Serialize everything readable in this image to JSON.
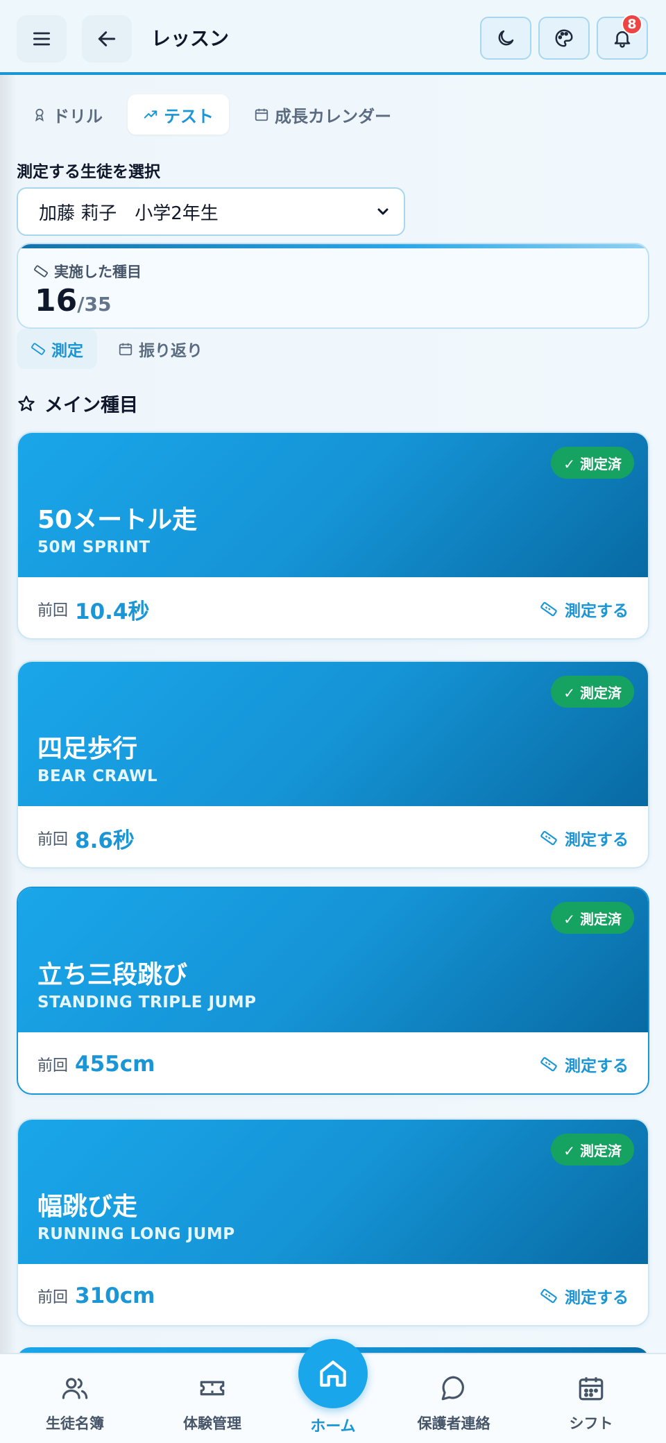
{
  "header": {
    "title": "レッスン",
    "notification_count": "8"
  },
  "tabs": [
    {
      "label": "ドリル",
      "icon": "award-icon"
    },
    {
      "label": "テスト",
      "icon": "trend-icon"
    },
    {
      "label": "成長カレンダー",
      "icon": "calendar-icon"
    }
  ],
  "student": {
    "label": "測定する生徒を選択",
    "selected": "加藤 莉子　小学2年生"
  },
  "stats": {
    "label": "実施した種目",
    "done": "16",
    "total": "/35"
  },
  "subtabs": [
    {
      "label": "測定",
      "icon": "ruler-icon"
    },
    {
      "label": "振り返り",
      "icon": "calendar-icon"
    }
  ],
  "section_title": "メイン種目",
  "events": [
    {
      "name": "50メートル走",
      "en": "50M SPRINT",
      "prev_label": "前回",
      "prev": "10.4秒",
      "status": "✓ 測定済",
      "action": "測定する"
    },
    {
      "name": "四足歩行",
      "en": "BEAR CRAWL",
      "prev_label": "前回",
      "prev": "8.6秒",
      "status": "✓ 測定済",
      "action": "測定する"
    },
    {
      "name": "立ち三段跳び",
      "en": "STANDING TRIPLE JUMP",
      "prev_label": "前回",
      "prev": "455cm",
      "status": "✓ 測定済",
      "action": "測定する"
    },
    {
      "name": "幅跳び走",
      "en": "RUNNING LONG JUMP",
      "prev_label": "前回",
      "prev": "310cm",
      "status": "✓ 測定済",
      "action": "測定する"
    }
  ],
  "nav": [
    {
      "label": "生徒名簿",
      "icon": "users-icon"
    },
    {
      "label": "体験管理",
      "icon": "ticket-icon"
    },
    {
      "label": "ホーム",
      "icon": "home-icon"
    },
    {
      "label": "保護者連絡",
      "icon": "chat-icon"
    },
    {
      "label": "シフト",
      "icon": "calendar-icon"
    }
  ],
  "colors": {
    "accent": "#1a96d6",
    "done": "#16a361",
    "badge": "#ef4444"
  }
}
